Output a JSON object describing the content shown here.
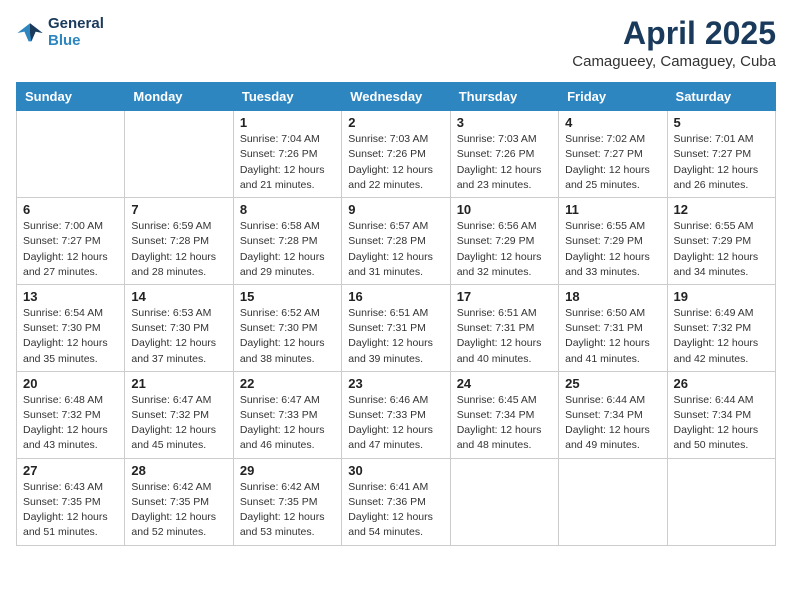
{
  "header": {
    "logo_line1": "General",
    "logo_line2": "Blue",
    "title": "April 2025",
    "subtitle": "Camagueey, Camaguey, Cuba"
  },
  "days_of_week": [
    "Sunday",
    "Monday",
    "Tuesday",
    "Wednesday",
    "Thursday",
    "Friday",
    "Saturday"
  ],
  "weeks": [
    [
      null,
      null,
      {
        "day": "1",
        "sunrise": "Sunrise: 7:04 AM",
        "sunset": "Sunset: 7:26 PM",
        "daylight": "Daylight: 12 hours and 21 minutes."
      },
      {
        "day": "2",
        "sunrise": "Sunrise: 7:03 AM",
        "sunset": "Sunset: 7:26 PM",
        "daylight": "Daylight: 12 hours and 22 minutes."
      },
      {
        "day": "3",
        "sunrise": "Sunrise: 7:03 AM",
        "sunset": "Sunset: 7:26 PM",
        "daylight": "Daylight: 12 hours and 23 minutes."
      },
      {
        "day": "4",
        "sunrise": "Sunrise: 7:02 AM",
        "sunset": "Sunset: 7:27 PM",
        "daylight": "Daylight: 12 hours and 25 minutes."
      },
      {
        "day": "5",
        "sunrise": "Sunrise: 7:01 AM",
        "sunset": "Sunset: 7:27 PM",
        "daylight": "Daylight: 12 hours and 26 minutes."
      }
    ],
    [
      {
        "day": "6",
        "sunrise": "Sunrise: 7:00 AM",
        "sunset": "Sunset: 7:27 PM",
        "daylight": "Daylight: 12 hours and 27 minutes."
      },
      {
        "day": "7",
        "sunrise": "Sunrise: 6:59 AM",
        "sunset": "Sunset: 7:28 PM",
        "daylight": "Daylight: 12 hours and 28 minutes."
      },
      {
        "day": "8",
        "sunrise": "Sunrise: 6:58 AM",
        "sunset": "Sunset: 7:28 PM",
        "daylight": "Daylight: 12 hours and 29 minutes."
      },
      {
        "day": "9",
        "sunrise": "Sunrise: 6:57 AM",
        "sunset": "Sunset: 7:28 PM",
        "daylight": "Daylight: 12 hours and 31 minutes."
      },
      {
        "day": "10",
        "sunrise": "Sunrise: 6:56 AM",
        "sunset": "Sunset: 7:29 PM",
        "daylight": "Daylight: 12 hours and 32 minutes."
      },
      {
        "day": "11",
        "sunrise": "Sunrise: 6:55 AM",
        "sunset": "Sunset: 7:29 PM",
        "daylight": "Daylight: 12 hours and 33 minutes."
      },
      {
        "day": "12",
        "sunrise": "Sunrise: 6:55 AM",
        "sunset": "Sunset: 7:29 PM",
        "daylight": "Daylight: 12 hours and 34 minutes."
      }
    ],
    [
      {
        "day": "13",
        "sunrise": "Sunrise: 6:54 AM",
        "sunset": "Sunset: 7:30 PM",
        "daylight": "Daylight: 12 hours and 35 minutes."
      },
      {
        "day": "14",
        "sunrise": "Sunrise: 6:53 AM",
        "sunset": "Sunset: 7:30 PM",
        "daylight": "Daylight: 12 hours and 37 minutes."
      },
      {
        "day": "15",
        "sunrise": "Sunrise: 6:52 AM",
        "sunset": "Sunset: 7:30 PM",
        "daylight": "Daylight: 12 hours and 38 minutes."
      },
      {
        "day": "16",
        "sunrise": "Sunrise: 6:51 AM",
        "sunset": "Sunset: 7:31 PM",
        "daylight": "Daylight: 12 hours and 39 minutes."
      },
      {
        "day": "17",
        "sunrise": "Sunrise: 6:51 AM",
        "sunset": "Sunset: 7:31 PM",
        "daylight": "Daylight: 12 hours and 40 minutes."
      },
      {
        "day": "18",
        "sunrise": "Sunrise: 6:50 AM",
        "sunset": "Sunset: 7:31 PM",
        "daylight": "Daylight: 12 hours and 41 minutes."
      },
      {
        "day": "19",
        "sunrise": "Sunrise: 6:49 AM",
        "sunset": "Sunset: 7:32 PM",
        "daylight": "Daylight: 12 hours and 42 minutes."
      }
    ],
    [
      {
        "day": "20",
        "sunrise": "Sunrise: 6:48 AM",
        "sunset": "Sunset: 7:32 PM",
        "daylight": "Daylight: 12 hours and 43 minutes."
      },
      {
        "day": "21",
        "sunrise": "Sunrise: 6:47 AM",
        "sunset": "Sunset: 7:32 PM",
        "daylight": "Daylight: 12 hours and 45 minutes."
      },
      {
        "day": "22",
        "sunrise": "Sunrise: 6:47 AM",
        "sunset": "Sunset: 7:33 PM",
        "daylight": "Daylight: 12 hours and 46 minutes."
      },
      {
        "day": "23",
        "sunrise": "Sunrise: 6:46 AM",
        "sunset": "Sunset: 7:33 PM",
        "daylight": "Daylight: 12 hours and 47 minutes."
      },
      {
        "day": "24",
        "sunrise": "Sunrise: 6:45 AM",
        "sunset": "Sunset: 7:34 PM",
        "daylight": "Daylight: 12 hours and 48 minutes."
      },
      {
        "day": "25",
        "sunrise": "Sunrise: 6:44 AM",
        "sunset": "Sunset: 7:34 PM",
        "daylight": "Daylight: 12 hours and 49 minutes."
      },
      {
        "day": "26",
        "sunrise": "Sunrise: 6:44 AM",
        "sunset": "Sunset: 7:34 PM",
        "daylight": "Daylight: 12 hours and 50 minutes."
      }
    ],
    [
      {
        "day": "27",
        "sunrise": "Sunrise: 6:43 AM",
        "sunset": "Sunset: 7:35 PM",
        "daylight": "Daylight: 12 hours and 51 minutes."
      },
      {
        "day": "28",
        "sunrise": "Sunrise: 6:42 AM",
        "sunset": "Sunset: 7:35 PM",
        "daylight": "Daylight: 12 hours and 52 minutes."
      },
      {
        "day": "29",
        "sunrise": "Sunrise: 6:42 AM",
        "sunset": "Sunset: 7:35 PM",
        "daylight": "Daylight: 12 hours and 53 minutes."
      },
      {
        "day": "30",
        "sunrise": "Sunrise: 6:41 AM",
        "sunset": "Sunset: 7:36 PM",
        "daylight": "Daylight: 12 hours and 54 minutes."
      },
      null,
      null,
      null
    ]
  ]
}
